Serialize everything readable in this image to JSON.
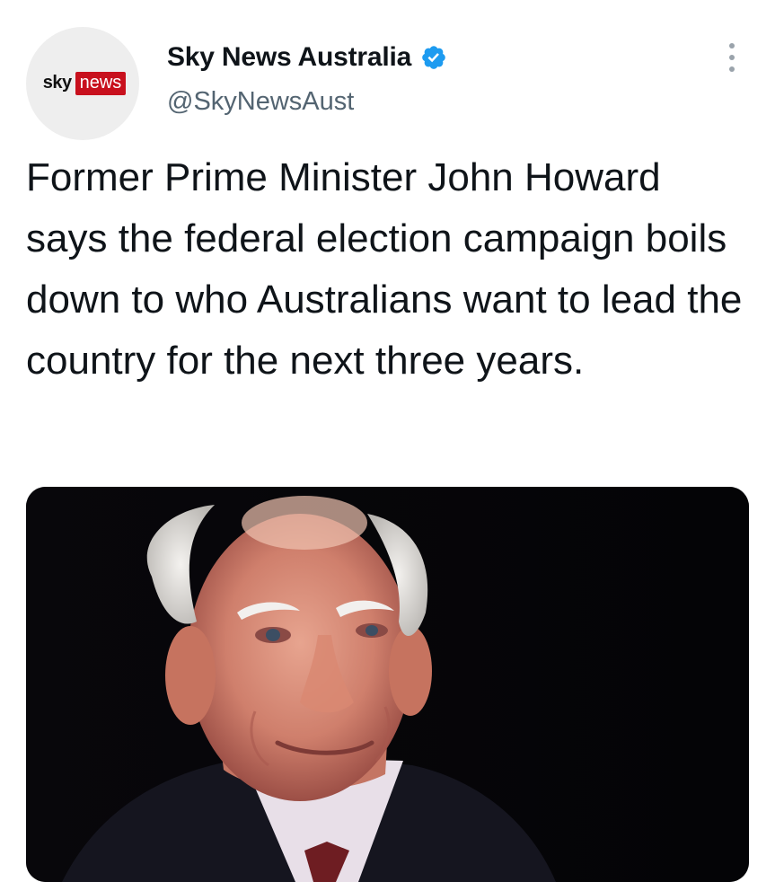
{
  "tweet": {
    "avatar": {
      "logo_sky": "sky",
      "logo_news": "news"
    },
    "display_name": "Sky News Australia",
    "handle": "@SkyNewsAust",
    "verified_icon": "verified-badge-icon",
    "more_icon": "more-vertical-icon",
    "text": "Former Prime Minister John Howard says the federal election campaign boils down to who Australians want to lead the country for the next three years.",
    "colors": {
      "verified_blue": "#1d9bf0",
      "brand_red": "#c8101d",
      "text_primary": "#0f1419",
      "text_secondary": "#536471"
    }
  }
}
